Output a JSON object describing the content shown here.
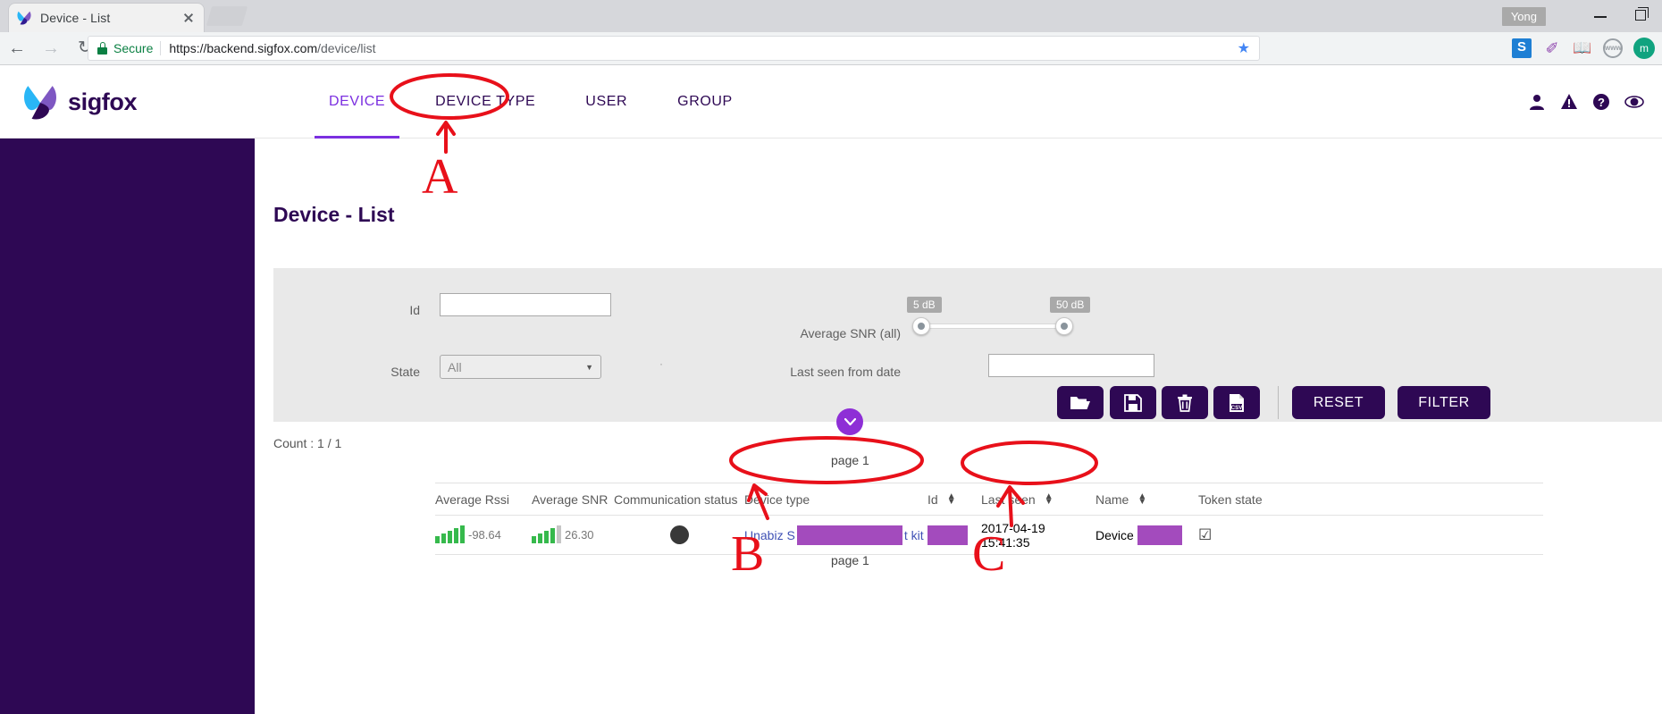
{
  "browser": {
    "tab": {
      "title": "Device - List",
      "favicon": "sigfox-butterfly-icon",
      "close": "close-icon"
    },
    "nav": {
      "back": "back-arrow-icon",
      "forward": "forward-arrow-icon",
      "reload": "reload-icon"
    },
    "omnibox": {
      "lock": "lock-icon",
      "secure_label": "Secure",
      "url_base": "https://backend.sigfox.com",
      "url_path": "/device/list",
      "star": "★"
    },
    "extensions": [
      {
        "name": "skype-extension-icon",
        "glyph": "S"
      },
      {
        "name": "pen-extension-icon",
        "glyph": "✐"
      },
      {
        "name": "book-extension-icon",
        "glyph": "📖"
      },
      {
        "name": "no-www-extension-icon",
        "glyph": "www"
      },
      {
        "name": "profile-avatar",
        "glyph": "m"
      }
    ],
    "window": {
      "user": "Yong",
      "minimize": "minimize-icon",
      "maximize": "maximize-icon"
    }
  },
  "app": {
    "brand": "sigfox",
    "nav": [
      {
        "label": "DEVICE",
        "active": true
      },
      {
        "label": "DEVICE TYPE",
        "active": false
      },
      {
        "label": "USER",
        "active": false
      },
      {
        "label": "GROUP",
        "active": false
      }
    ],
    "header_icons": [
      {
        "name": "user-icon"
      },
      {
        "name": "warning-icon"
      },
      {
        "name": "help-icon"
      },
      {
        "name": "eye-icon"
      }
    ],
    "page_title": "Device - List"
  },
  "filters": {
    "id": {
      "label": "Id",
      "value": "",
      "placeholder": ""
    },
    "state": {
      "label": "State",
      "value": "All",
      "caret": "▼"
    },
    "snr": {
      "label": "Average SNR (all)",
      "min_tip": "5 dB",
      "max_tip": "50 dB",
      "min_value": 5,
      "max_value": 50
    },
    "last_seen": {
      "label": "Last seen from date",
      "value": "",
      "placeholder": ""
    },
    "buttons": [
      {
        "name": "load-filter-button",
        "icon": "folder-open-icon"
      },
      {
        "name": "save-filter-button",
        "icon": "floppy-save-icon"
      },
      {
        "name": "delete-filter-button",
        "icon": "trash-icon"
      },
      {
        "name": "export-csv-button",
        "icon": "csv-file-icon"
      }
    ],
    "reset_label": "RESET",
    "filter_label": "FILTER",
    "expand_icon": "chevron-down-icon"
  },
  "results": {
    "count_text": "Count : 1 / 1",
    "page_top": "page 1",
    "page_bottom": "page 1",
    "columns": [
      {
        "key": "avg_rssi",
        "label": "Average Rssi",
        "sortable": false
      },
      {
        "key": "avg_snr",
        "label": "Average SNR",
        "sortable": false
      },
      {
        "key": "comm_status",
        "label": "Communication status",
        "sortable": false
      },
      {
        "key": "device_type",
        "label": "Device type",
        "sortable": false
      },
      {
        "key": "id",
        "label": "Id",
        "sortable": true
      },
      {
        "key": "last_seen",
        "label": "Last seen",
        "sortable": true
      },
      {
        "key": "name",
        "label": "Name",
        "sortable": true
      },
      {
        "key": "token_state",
        "label": "Token state",
        "sortable": false
      }
    ],
    "rows": [
      {
        "avg_rssi_value": "-98.64",
        "avg_rssi_bars": 5,
        "avg_rssi_bars_total": 5,
        "avg_snr_value": "26.30",
        "avg_snr_bars": 4,
        "avg_snr_bars_total": 5,
        "comm_status": "filled-dot",
        "device_type_prefix": "Unabiz S",
        "device_type_suffix": "t kit",
        "id_prefix": "",
        "last_seen": "2017-04-19 15:41:35",
        "name_prefix": "Device",
        "token_state": "☑"
      }
    ]
  },
  "annotations": {
    "color": "#e8101a",
    "letters": [
      {
        "text": "A",
        "target": "device-type-nav"
      },
      {
        "text": "B",
        "target": "device-type-cell"
      },
      {
        "text": "C",
        "target": "last-seen-cell"
      }
    ],
    "ellipses": [
      {
        "target": "device-type-nav"
      },
      {
        "target": "device-type-cell"
      },
      {
        "target": "last-seen-cell"
      }
    ]
  }
}
